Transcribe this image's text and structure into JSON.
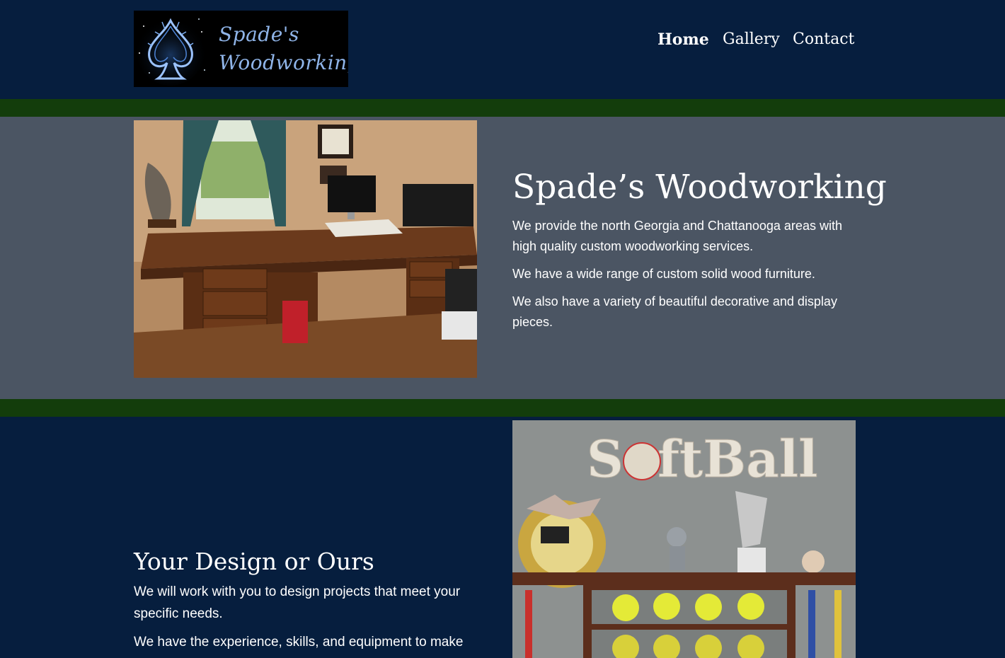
{
  "header": {
    "logo": {
      "line1": "Spade's",
      "line2": "Woodworking"
    },
    "nav": [
      {
        "label": "Home",
        "active": true
      },
      {
        "label": "Gallery",
        "active": false
      },
      {
        "label": "Contact",
        "active": false
      }
    ]
  },
  "hero": {
    "title": "Spade’s Woodworking",
    "paragraphs": [
      "We provide the north Georgia and Chattanooga areas with high quality custom woodworking services.",
      "We have a wide range of custom solid wood furniture.",
      "We also have a variety of beautiful decorative and display pieces."
    ]
  },
  "design": {
    "title": "Your Design or Ours",
    "paragraphs": [
      "We will work with you to design projects that meet your specific needs.",
      "We have the experience, skills, and equipment to make"
    ]
  },
  "photo_text": {
    "softball_sign": "SoftBall"
  },
  "colors": {
    "header_bg": "#061e3e",
    "divider_green": "#133d0b",
    "section_gray": "#4b5563",
    "logo_text": "#8fb4e8"
  }
}
